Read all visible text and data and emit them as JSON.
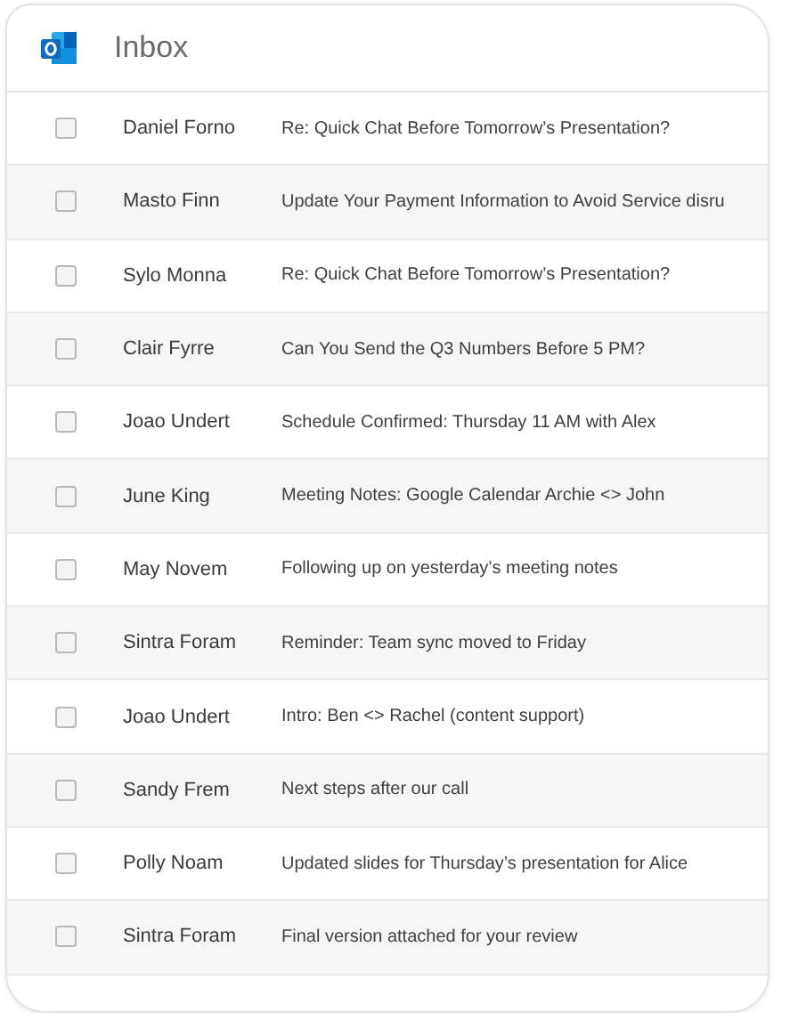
{
  "header": {
    "title": "Inbox"
  },
  "emails": [
    {
      "sender": "Daniel Forno",
      "subject": "Re: Quick Chat Before Tomorrow’s Presentation?",
      "checked": false
    },
    {
      "sender": "Masto Finn",
      "subject": "Update Your Payment Information to Avoid Service disru",
      "checked": false
    },
    {
      "sender": "Sylo Monna",
      "subject": "Re: Quick Chat Before Tomorrow’s Presentation?",
      "checked": false
    },
    {
      "sender": "Clair Fyrre",
      "subject": "Can You Send the Q3 Numbers Before 5 PM?",
      "checked": false
    },
    {
      "sender": "Joao Undert",
      "subject": "Schedule Confirmed: Thursday 11 AM with Alex",
      "checked": false
    },
    {
      "sender": "June King",
      "subject": "Meeting Notes: Google Calendar Archie <> John",
      "checked": false
    },
    {
      "sender": "May Novem",
      "subject": "Following up on yesterday’s meeting notes",
      "checked": false
    },
    {
      "sender": "Sintra Foram",
      "subject": "Reminder: Team sync moved to Friday",
      "checked": false
    },
    {
      "sender": "Joao Undert",
      "subject": "Intro: Ben <> Rachel (content support)",
      "checked": false
    },
    {
      "sender": "Sandy Frem",
      "subject": "Next steps after our call",
      "checked": false
    },
    {
      "sender": "Polly Noam",
      "subject": "Updated slides for Thursday’s presentation for Alice",
      "checked": false
    },
    {
      "sender": "Sintra Foram",
      "subject": "Final version attached for your review",
      "checked": false
    }
  ]
}
